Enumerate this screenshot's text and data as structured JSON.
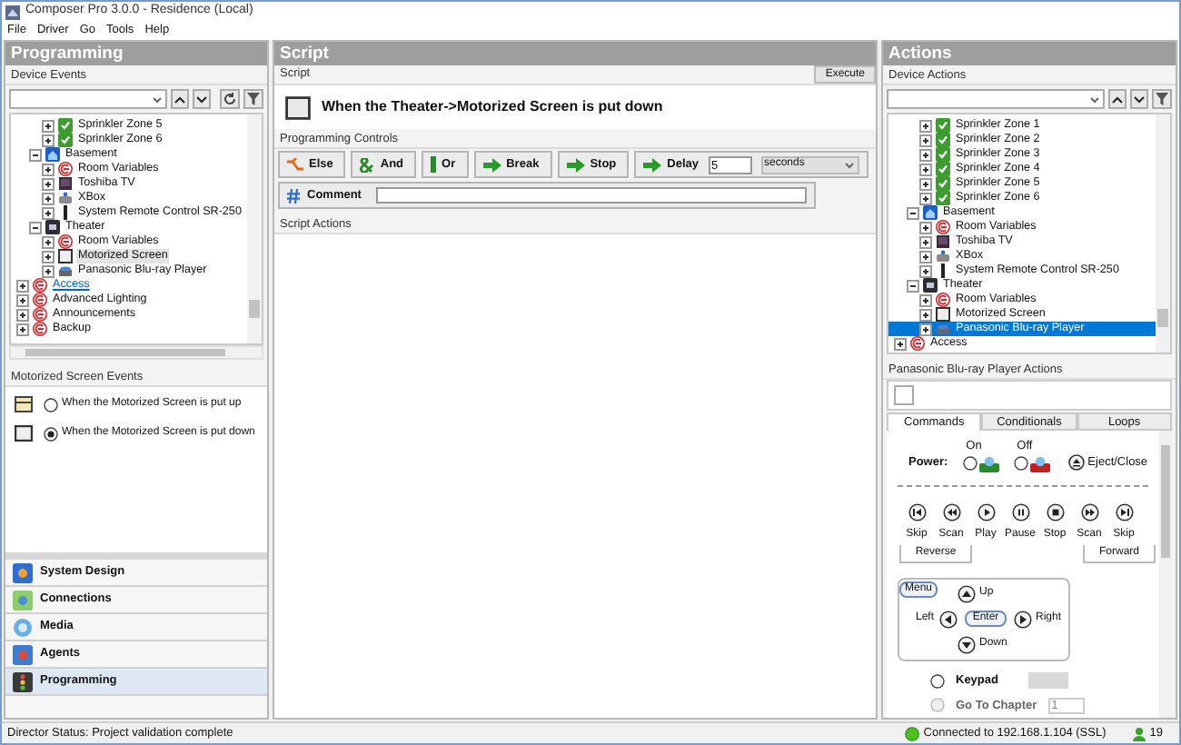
{
  "window": {
    "title": "Composer Pro 3.0.0 - Residence (Local)"
  },
  "menu": [
    "File",
    "Driver",
    "Go",
    "Tools",
    "Help"
  ],
  "left_panel": {
    "title": "Programming",
    "section": "Device Events",
    "tree": {
      "continued_items": [
        {
          "label": "Sprinkler Zone 5",
          "kind": "sprinkler",
          "expanded": false,
          "selected": false
        },
        {
          "label": "Sprinkler Zone 6",
          "kind": "sprinkler",
          "expanded": false,
          "selected": false
        }
      ],
      "rooms": [
        {
          "label": "Basement",
          "kind": "basement",
          "expanded": true,
          "selected": false,
          "children": [
            {
              "label": "Room Variables",
              "kind": "variables",
              "expanded": false,
              "selected": false
            },
            {
              "label": "Toshiba TV",
              "kind": "tv",
              "expanded": false,
              "selected": false
            },
            {
              "label": "XBox",
              "kind": "console",
              "expanded": false,
              "selected": false
            },
            {
              "label": "System Remote Control SR-250",
              "kind": "remote",
              "expanded": false,
              "selected": false
            }
          ]
        },
        {
          "label": "Theater",
          "kind": "theater",
          "expanded": true,
          "selected": false,
          "children": [
            {
              "label": "Room Variables",
              "kind": "variables",
              "expanded": false,
              "selected": false
            },
            {
              "label": "Motorized Screen",
              "kind": "screen",
              "expanded": false,
              "selected": true
            },
            {
              "label": "Panasonic Blu-ray Player",
              "kind": "player",
              "expanded": false,
              "selected": false
            }
          ]
        }
      ],
      "agents": [
        {
          "label": "Access",
          "kind": "agent",
          "expanded": false,
          "hovered": true
        },
        {
          "label": "Advanced Lighting",
          "kind": "agent",
          "expanded": false,
          "hovered": false
        },
        {
          "label": "Announcements",
          "kind": "agent",
          "expanded": false,
          "hovered": false
        },
        {
          "label": "Backup",
          "kind": "agent",
          "expanded": false,
          "hovered": false
        }
      ]
    },
    "events": {
      "title": "Motorized Screen Events",
      "options": [
        {
          "label": "When the Motorized Screen is put up",
          "kind": "up",
          "selected": false
        },
        {
          "label": "When the Motorized Screen is put down",
          "kind": "down",
          "selected": true
        }
      ]
    },
    "nav": [
      {
        "label": "System Design",
        "kind": "design",
        "selected": false
      },
      {
        "label": "Connections",
        "kind": "connections",
        "selected": false
      },
      {
        "label": "Media",
        "kind": "media",
        "selected": false
      },
      {
        "label": "Agents",
        "kind": "agents",
        "selected": false
      },
      {
        "label": "Programming",
        "kind": "programming",
        "selected": true
      }
    ]
  },
  "script_panel": {
    "title": "Script",
    "section": "Script",
    "execute": "Execute",
    "event": "When the Theater->Motorized Screen is put down",
    "controls_title": "Programming Controls",
    "controls": [
      {
        "label": "Else",
        "kind": "else"
      },
      {
        "label": "And",
        "kind": "and"
      },
      {
        "label": "Or",
        "kind": "or"
      },
      {
        "label": "Break",
        "kind": "arrow"
      },
      {
        "label": "Stop",
        "kind": "arrow"
      },
      {
        "label": "Delay",
        "kind": "arrow"
      }
    ],
    "delay_value": "5",
    "delay_unit": "seconds",
    "comment": "Comment",
    "actions_title": "Script Actions"
  },
  "actions_panel": {
    "title": "Actions",
    "section": "Device Actions",
    "tree": {
      "continued_items": [
        {
          "label": "Sprinkler Zone 1",
          "kind": "sprinkler",
          "expanded": false,
          "selected": false
        },
        {
          "label": "Sprinkler Zone 2",
          "kind": "sprinkler",
          "expanded": false,
          "selected": false
        },
        {
          "label": "Sprinkler Zone 3",
          "kind": "sprinkler",
          "expanded": false,
          "selected": false
        },
        {
          "label": "Sprinkler Zone 4",
          "kind": "sprinkler",
          "expanded": false,
          "selected": false
        },
        {
          "label": "Sprinkler Zone 5",
          "kind": "sprinkler",
          "expanded": false,
          "selected": false
        },
        {
          "label": "Sprinkler Zone 6",
          "kind": "sprinkler",
          "expanded": false,
          "selected": false
        }
      ],
      "rooms": [
        {
          "label": "Basement",
          "kind": "basement",
          "expanded": true,
          "selected": false,
          "children": [
            {
              "label": "Room Variables",
              "kind": "variables",
              "expanded": false,
              "selected": false
            },
            {
              "label": "Toshiba TV",
              "kind": "tv",
              "expanded": false,
              "selected": false
            },
            {
              "label": "XBox",
              "kind": "console",
              "expanded": false,
              "selected": false
            },
            {
              "label": "System Remote Control SR-250",
              "kind": "remote",
              "expanded": false,
              "selected": false
            }
          ]
        },
        {
          "label": "Theater",
          "kind": "theater",
          "expanded": true,
          "selected": false,
          "children": [
            {
              "label": "Room Variables",
              "kind": "variables",
              "expanded": false,
              "selected": false
            },
            {
              "label": "Motorized Screen",
              "kind": "screen",
              "expanded": false,
              "selected": false
            },
            {
              "label": "Panasonic Blu-ray Player",
              "kind": "player",
              "expanded": false,
              "selected": true
            }
          ]
        }
      ],
      "agents": [
        {
          "label": "Access",
          "kind": "agent",
          "expanded": false,
          "hovered": false
        }
      ]
    },
    "device_actions_title": "Panasonic Blu-ray Player Actions",
    "tabs": [
      {
        "label": "Commands",
        "selected": true
      },
      {
        "label": "Conditionals",
        "selected": false
      },
      {
        "label": "Loops",
        "selected": false
      }
    ],
    "commands": {
      "power_label": "Power:",
      "power_options": [
        {
          "label": "On",
          "kind": "on",
          "selected": false
        },
        {
          "label": "Off",
          "kind": "off",
          "selected": false
        }
      ],
      "eject": "Eject/Close",
      "transport": [
        {
          "label": "Skip",
          "kind": "skip_back"
        },
        {
          "label": "Scan",
          "kind": "scan_back"
        },
        {
          "label": "Play",
          "kind": "play"
        },
        {
          "label": "Pause",
          "kind": "pause"
        },
        {
          "label": "Stop",
          "kind": "stop"
        },
        {
          "label": "Scan",
          "kind": "scan_fwd"
        },
        {
          "label": "Skip",
          "kind": "skip_fwd"
        }
      ],
      "reverse": "Reverse",
      "forward": "Forward",
      "navigation": {
        "menu": "Menu",
        "up": "Up",
        "left": "Left",
        "enter": "Enter",
        "right": "Right",
        "down": "Down"
      },
      "keypad": {
        "label": "Keypad",
        "selected": false
      },
      "chapter": {
        "label": "Go To Chapter",
        "selected": false,
        "disabled": true,
        "value": "1"
      }
    }
  },
  "status_bar": {
    "status": "Director Status: Project validation complete",
    "connection": "Connected to 192.168.1.104 (SSL)",
    "count": "19"
  }
}
